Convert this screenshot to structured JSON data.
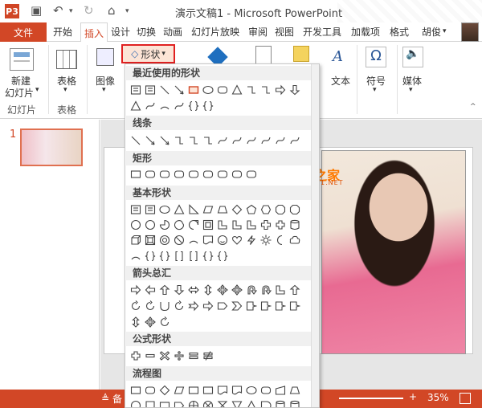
{
  "window": {
    "title": "演示文稿1 - Microsoft PowerPoint",
    "app_icon": "P3"
  },
  "tabs": {
    "file": "文件",
    "items": [
      "开始",
      "插入",
      "设计",
      "切换",
      "动画",
      "幻灯片放映",
      "审阅",
      "视图",
      "开发工具",
      "加载项",
      "格式"
    ],
    "active": "插入",
    "user": "胡俊"
  },
  "ribbon": {
    "new_slide": "新建",
    "new_slide2": "幻灯片",
    "slides_group": "幻灯片",
    "table": "表格",
    "tables_group": "表格",
    "image": "图像",
    "shapes": "形状",
    "text": "文本",
    "symbol": "符号",
    "media": "媒体"
  },
  "dropdown": {
    "sections": [
      "最近使用的形状",
      "线条",
      "矩形",
      "基本形状",
      "箭头总汇",
      "公式形状",
      "流程图"
    ]
  },
  "slide_panel": {
    "slide_number": "1"
  },
  "watermark": {
    "main": "office之家",
    "sub": "OFFICE.JB51.NET"
  },
  "statusbar": {
    "notes": "备",
    "zoom": "35%"
  },
  "colors": {
    "accent": "#d24726",
    "highlight": "#e02020"
  }
}
